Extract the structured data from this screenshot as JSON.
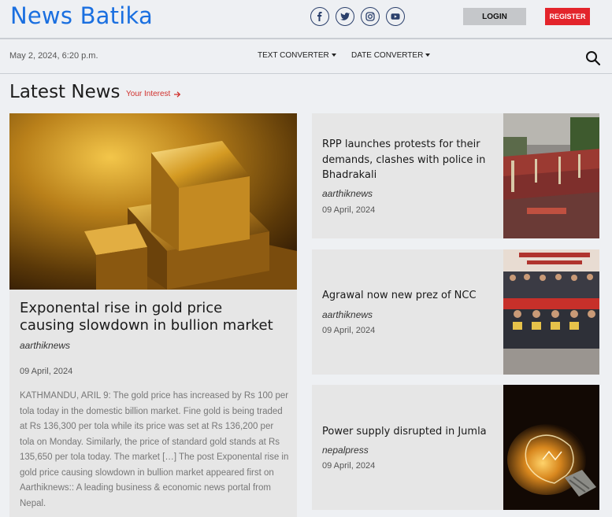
{
  "header": {
    "logo": "News Batika",
    "login_label": "LOGIN",
    "register_label": "REGISTER",
    "social_icons": [
      "facebook-icon",
      "twitter-icon",
      "instagram-icon",
      "youtube-icon"
    ]
  },
  "subbar": {
    "date": "May 2, 2024, 6:20 p.m.",
    "menu": [
      "TEXT CONVERTER",
      "DATE CONVERTER"
    ]
  },
  "section": {
    "title": "Latest News",
    "interest_label": "Your Interest"
  },
  "feature": {
    "title": "Exponental rise in gold price causing slowdown in bullion market",
    "source": "aarthiknews",
    "date": "09 April, 2024",
    "body": "KATHMANDU, ARIL 9: The gold price has increased by Rs 100 per tola today in the domestic billion market. Fine gold is being traded at Rs 136,300 per tola while its price was set at Rs 136,200 per tola on Monday. Similarly, the price of standard gold stands at Rs 135,650 per tola today. The market […] The post Exponental rise in gold price causing slowdown in bullion market appeared first on Aarthiknews:: A leading business & economic news portal from Nepal."
  },
  "articles": [
    {
      "title": "RPP launches protests for their demands, clashes with police in Bhadrakali",
      "source": "aarthiknews",
      "date": "09 April, 2024"
    },
    {
      "title": "Agrawal now new prez of NCC",
      "source": "aarthiknews",
      "date": "09 April, 2024"
    },
    {
      "title": "Power supply disrupted in Jumla",
      "source": "nepalpress",
      "date": "09 April, 2024"
    }
  ],
  "colors": {
    "brand": "#1a6fe0",
    "register": "#e3242b",
    "accent": "#d0302c"
  }
}
